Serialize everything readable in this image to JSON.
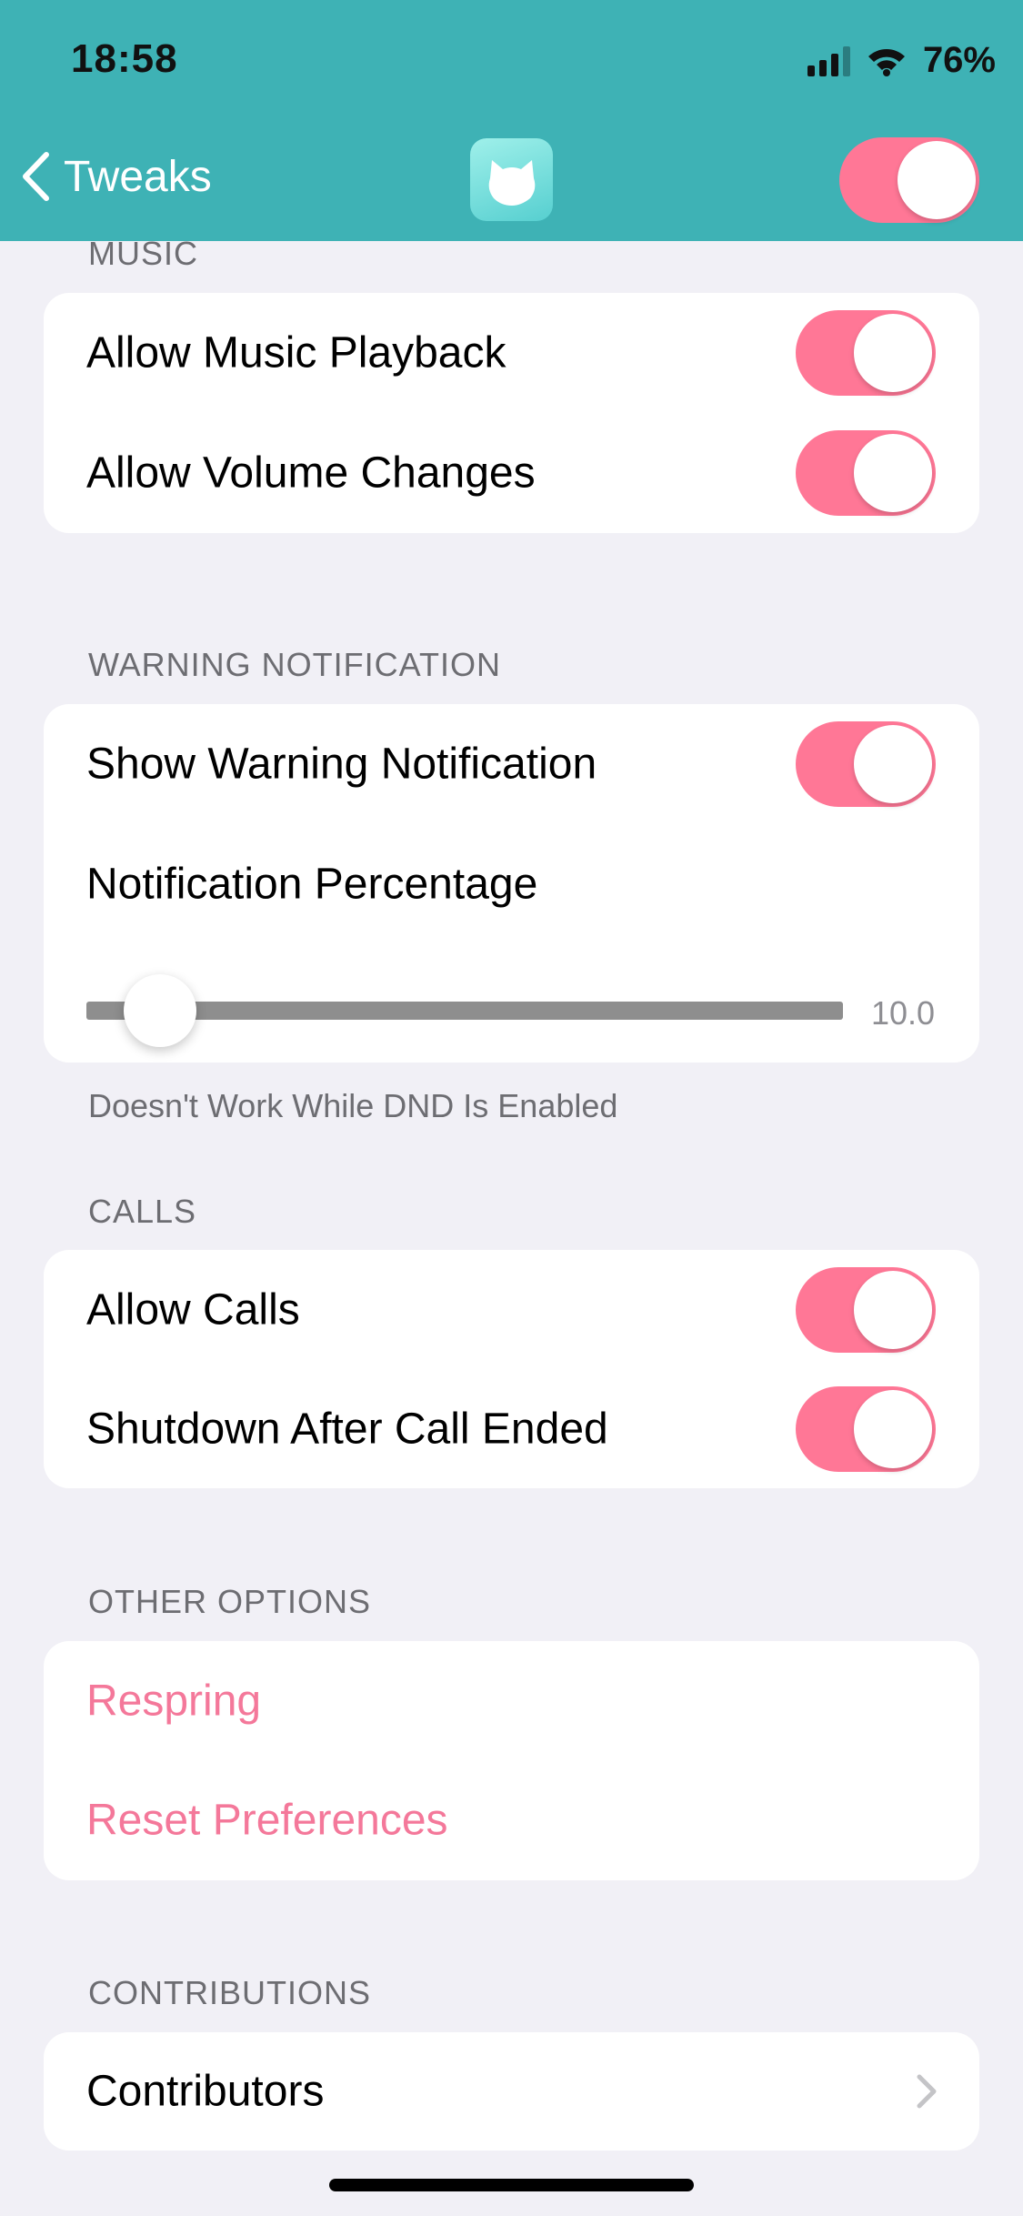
{
  "status_bar": {
    "time": "18:58",
    "battery": "76%"
  },
  "nav": {
    "back_label": "Tweaks",
    "app_icon": "cat-icon",
    "master_toggle_on": true
  },
  "colors": {
    "header": "#3eb2b5",
    "accent": "#ff7796",
    "destructive_text": "#f4789a",
    "background": "#f1f0f6"
  },
  "sections": {
    "music": {
      "header": "MUSIC",
      "rows": [
        {
          "label": "Allow Music Playback",
          "on": true
        },
        {
          "label": "Allow Volume Changes",
          "on": true
        }
      ]
    },
    "warning": {
      "header": "WARNING NOTIFICATION",
      "rows": [
        {
          "label": "Show Warning Notification",
          "on": true
        },
        {
          "label": "Notification Percentage"
        }
      ],
      "slider": {
        "value": 10.0,
        "value_label": "10.0"
      },
      "footer": "Doesn't Work While DND Is Enabled"
    },
    "calls": {
      "header": "CALLS",
      "rows": [
        {
          "label": "Allow Calls",
          "on": true
        },
        {
          "label": "Shutdown After Call Ended",
          "on": true
        }
      ]
    },
    "other": {
      "header": "OTHER OPTIONS",
      "rows": [
        {
          "label": "Respring"
        },
        {
          "label": "Reset Preferences"
        }
      ]
    },
    "contributions": {
      "header": "CONTRIBUTIONS",
      "rows": [
        {
          "label": "Contributors"
        }
      ]
    }
  }
}
